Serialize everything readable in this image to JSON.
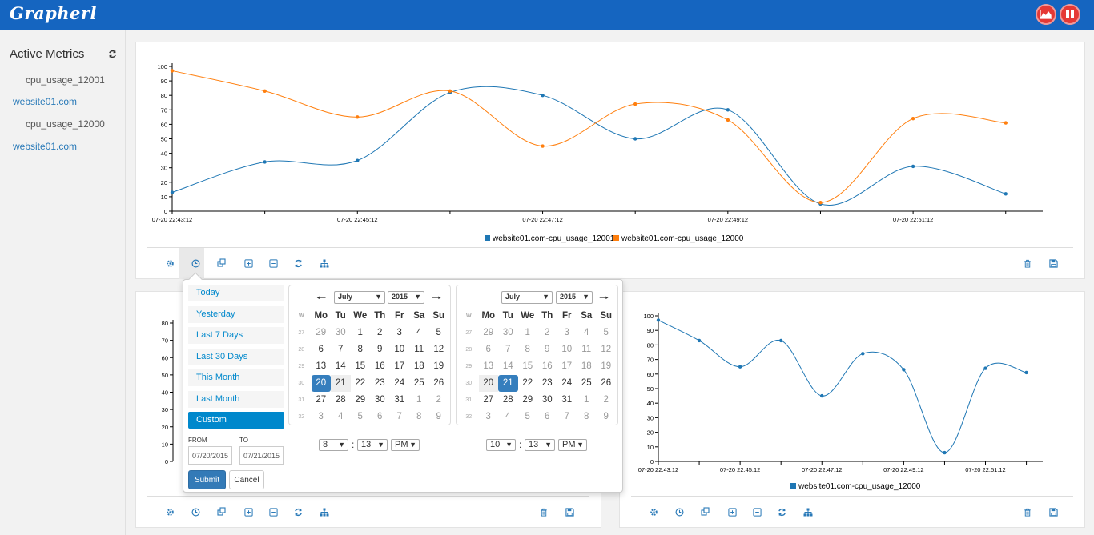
{
  "app": {
    "title": "Grapherl"
  },
  "header": {
    "chart_icon": "area-chart-icon",
    "pause_icon": "pause-icon"
  },
  "sidebar": {
    "title": "Active Metrics",
    "items": [
      {
        "label": "cpu_usage_12001",
        "kind": "metric"
      },
      {
        "label": "website01.com",
        "kind": "host"
      },
      {
        "label": "cpu_usage_12000",
        "kind": "metric"
      },
      {
        "label": "website01.com",
        "kind": "host"
      }
    ]
  },
  "colors": {
    "series_blue": "#1f77b4",
    "series_orange": "#ff7f0e",
    "header": "#1565c0",
    "accent": "#0088cc"
  },
  "toolbar_icons": [
    "gear-icon",
    "clock-icon",
    "clone-icon",
    "zoom-in-icon",
    "zoom-out-icon",
    "refresh-icon",
    "sitemap-icon",
    "trash-icon",
    "save-icon"
  ],
  "chart_data": [
    {
      "type": "line",
      "x_ticks": [
        "07-20 22:43:12",
        "07-20 22:45:12",
        "07-20 22:47:12",
        "07-20 22:49:12",
        "07-20 22:51:12"
      ],
      "ylim": [
        0,
        100
      ],
      "y_ticks": [
        0,
        10,
        20,
        30,
        40,
        50,
        60,
        70,
        80,
        90,
        100
      ],
      "grid": false,
      "legend_position": "bottom",
      "series": [
        {
          "name": "website01.com-cpu_usage_12001",
          "color": "#1f77b4",
          "values": [
            13,
            34,
            35,
            82,
            80,
            50,
            70,
            5,
            31,
            12
          ]
        },
        {
          "name": "website01.com-cpu_usage_12000",
          "color": "#ff7f0e",
          "values": [
            97,
            83,
            65,
            83,
            45,
            74,
            63,
            6,
            64,
            61
          ]
        }
      ]
    },
    {
      "type": "line",
      "y_ticks": [
        0,
        10,
        20,
        30,
        40,
        50,
        60,
        70,
        80
      ],
      "grid": false,
      "series": []
    },
    {
      "type": "line",
      "x_ticks": [
        "07-20 22:43:12",
        "07-20 22:45:12",
        "07-20 22:47:12",
        "07-20 22:49:12",
        "07-20 22:51:12"
      ],
      "ylim": [
        0,
        100
      ],
      "y_ticks": [
        0,
        10,
        20,
        30,
        40,
        50,
        60,
        70,
        80,
        90,
        100
      ],
      "grid": false,
      "legend_position": "bottom",
      "series": [
        {
          "name": "website01.com-cpu_usage_12000",
          "color": "#1f77b4",
          "values": [
            97,
            83,
            65,
            83,
            45,
            74,
            63,
            6,
            64,
            61
          ]
        }
      ]
    }
  ],
  "datepicker": {
    "ranges": [
      "Today",
      "Yesterday",
      "Last 7 Days",
      "Last 30 Days",
      "This Month",
      "Last Month",
      "Custom"
    ],
    "active_range": "Custom",
    "from_label": "FROM",
    "to_label": "TO",
    "from_value": "07/20/2015",
    "to_value": "07/21/2015",
    "submit_label": "Submit",
    "cancel_label": "Cancel",
    "weekday_header": [
      "W",
      "Mo",
      "Tu",
      "We",
      "Th",
      "Fr",
      "Sa",
      "Su"
    ],
    "left": {
      "month": "July",
      "year": "2015",
      "hour": "8",
      "minute": "13",
      "ampm": "PM",
      "weeks": [
        {
          "w": "27",
          "days": [
            "29",
            "30",
            "1",
            "2",
            "3",
            "4",
            "5"
          ]
        },
        {
          "w": "28",
          "days": [
            "6",
            "7",
            "8",
            "9",
            "10",
            "11",
            "12"
          ]
        },
        {
          "w": "29",
          "days": [
            "13",
            "14",
            "15",
            "16",
            "17",
            "18",
            "19"
          ]
        },
        {
          "w": "30",
          "days": [
            "20",
            "21",
            "22",
            "23",
            "24",
            "25",
            "26"
          ]
        },
        {
          "w": "31",
          "days": [
            "27",
            "28",
            "29",
            "30",
            "31",
            "1",
            "2"
          ]
        },
        {
          "w": "32",
          "days": [
            "3",
            "4",
            "5",
            "6",
            "7",
            "8",
            "9"
          ]
        }
      ]
    },
    "right": {
      "month": "July",
      "year": "2015",
      "hour": "10",
      "minute": "13",
      "ampm": "PM",
      "weeks": [
        {
          "w": "27",
          "days": [
            "29",
            "30",
            "1",
            "2",
            "3",
            "4",
            "5"
          ]
        },
        {
          "w": "28",
          "days": [
            "6",
            "7",
            "8",
            "9",
            "10",
            "11",
            "12"
          ]
        },
        {
          "w": "29",
          "days": [
            "13",
            "14",
            "15",
            "16",
            "17",
            "18",
            "19"
          ]
        },
        {
          "w": "30",
          "days": [
            "20",
            "21",
            "22",
            "23",
            "24",
            "25",
            "26"
          ]
        },
        {
          "w": "31",
          "days": [
            "27",
            "28",
            "29",
            "30",
            "31",
            "1",
            "2"
          ]
        },
        {
          "w": "32",
          "days": [
            "3",
            "4",
            "5",
            "6",
            "7",
            "8",
            "9"
          ]
        }
      ]
    }
  }
}
